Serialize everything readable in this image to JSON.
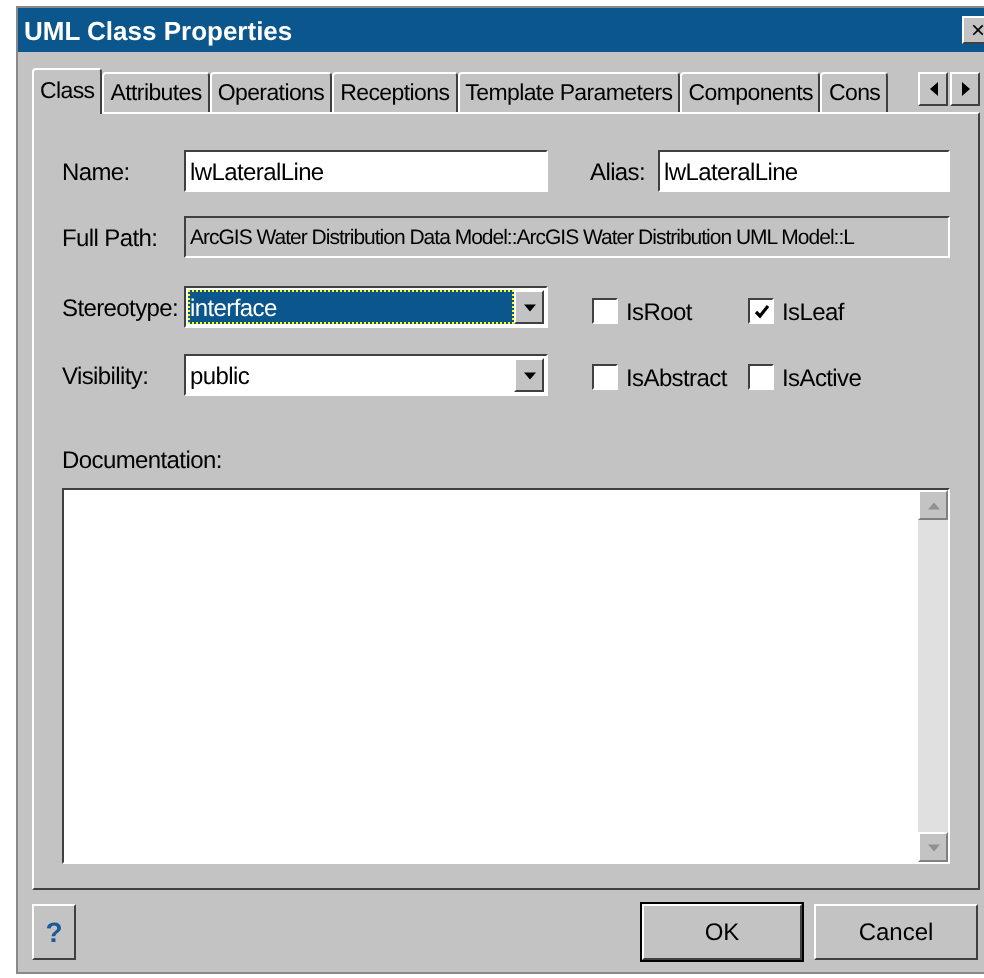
{
  "window": {
    "title": "UML Class Properties",
    "close": "×"
  },
  "tabs": [
    {
      "label": "Class",
      "selected": true
    },
    {
      "label": "Attributes",
      "selected": false
    },
    {
      "label": "Operations",
      "selected": false
    },
    {
      "label": "Receptions",
      "selected": false
    },
    {
      "label": "Template Parameters",
      "selected": false
    },
    {
      "label": "Components",
      "selected": false
    },
    {
      "label": "Cons",
      "selected": false
    }
  ],
  "name": {
    "label": "Name:",
    "value": "lwLateralLine"
  },
  "alias": {
    "label": "Alias:",
    "value": "lwLateralLine"
  },
  "full_path": {
    "label": "Full Path:",
    "value": "ArcGIS Water Distribution Data Model::ArcGIS Water Distribution UML Model::L"
  },
  "stereotype": {
    "label": "Stereotype:",
    "value": "interface",
    "focused": true
  },
  "visibility": {
    "label": "Visibility:",
    "value": "public",
    "focused": false
  },
  "flags": [
    {
      "label": "IsRoot",
      "checked": false
    },
    {
      "label": "IsLeaf",
      "checked": true
    },
    {
      "label": "IsAbstract",
      "checked": false
    },
    {
      "label": "IsActive",
      "checked": false
    }
  ],
  "documentation": {
    "label": "Documentation:"
  },
  "buttons": {
    "help": "?",
    "ok": "OK",
    "cancel": "Cancel"
  }
}
